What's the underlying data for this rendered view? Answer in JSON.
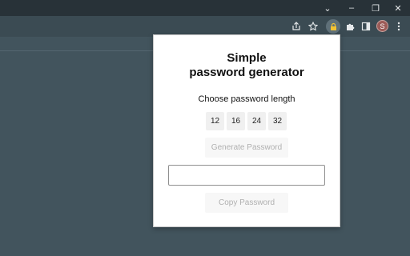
{
  "window": {
    "controls": {
      "chevron": "⌄",
      "minimize": "–",
      "restore": "❐",
      "close": "✕"
    }
  },
  "toolbar": {
    "icons": [
      "share-icon",
      "star-icon",
      "lock-extension-icon",
      "puzzle-icon",
      "sidepanel-icon",
      "menu-icon"
    ],
    "profile_initial": "S"
  },
  "popup": {
    "title": "Simple\npassword generator",
    "title_line1": "Simple",
    "title_line2": "password generator",
    "length_label": "Choose password length",
    "length_options": [
      "12",
      "16",
      "24",
      "32"
    ],
    "generate_label": "Generate Password",
    "password_value": "",
    "copy_label": "Copy Password"
  },
  "colors": {
    "page_bg": "#42545d",
    "titlebar_bg": "#283238",
    "toolbar_bg": "#3b4b53",
    "popup_bg": "#ffffff",
    "disabled_text": "#b0b0b0"
  }
}
